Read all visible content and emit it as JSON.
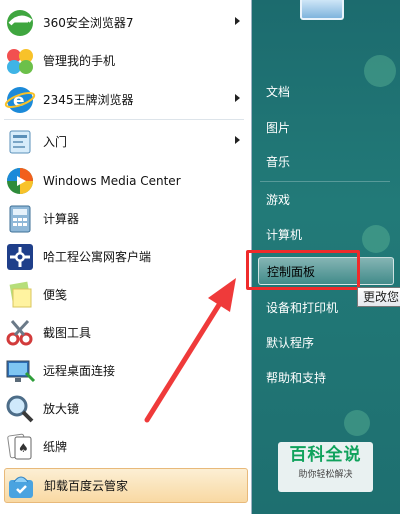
{
  "left_menu": {
    "items": [
      {
        "label": "360安全浏览器7",
        "icon": "360-browser-icon",
        "has_submenu": true
      },
      {
        "label": "管理我的手机",
        "icon": "phone-manager-icon",
        "has_submenu": false
      },
      {
        "label": "2345王牌浏览器",
        "icon": "2345-browser-icon",
        "has_submenu": true
      },
      {
        "label": "入门",
        "icon": "getting-started-icon",
        "has_submenu": true
      },
      {
        "label": "Windows Media Center",
        "icon": "media-center-icon",
        "has_submenu": false
      },
      {
        "label": "计算器",
        "icon": "calculator-icon",
        "has_submenu": false
      },
      {
        "label": "哈工程公寓网客户端",
        "icon": "network-client-icon",
        "has_submenu": false
      },
      {
        "label": "便笺",
        "icon": "sticky-notes-icon",
        "has_submenu": false
      },
      {
        "label": "截图工具",
        "icon": "snipping-tool-icon",
        "has_submenu": false
      },
      {
        "label": "远程桌面连接",
        "icon": "remote-desktop-icon",
        "has_submenu": false
      },
      {
        "label": "放大镜",
        "icon": "magnifier-icon",
        "has_submenu": false
      },
      {
        "label": "纸牌",
        "icon": "solitaire-icon",
        "has_submenu": false
      },
      {
        "label": "卸载百度云管家",
        "icon": "baidu-cloud-uninstall-icon",
        "has_submenu": false
      }
    ]
  },
  "right_menu": {
    "items": [
      {
        "label": "文档"
      },
      {
        "label": "图片"
      },
      {
        "label": "音乐"
      },
      {
        "label": "游戏"
      },
      {
        "label": "计算机"
      },
      {
        "label": "控制面板"
      },
      {
        "label": "设备和打印机"
      },
      {
        "label": "默认程序"
      },
      {
        "label": "帮助和支持"
      }
    ]
  },
  "tooltip": {
    "text": "更改您"
  },
  "watermark": {
    "title": "百科全说",
    "subtitle": "助你轻松解决"
  },
  "colors": {
    "annotation_red": "#ef2b2b",
    "panel_teal": "#1f6e72",
    "highlight_orange": "#f9d9a3"
  }
}
